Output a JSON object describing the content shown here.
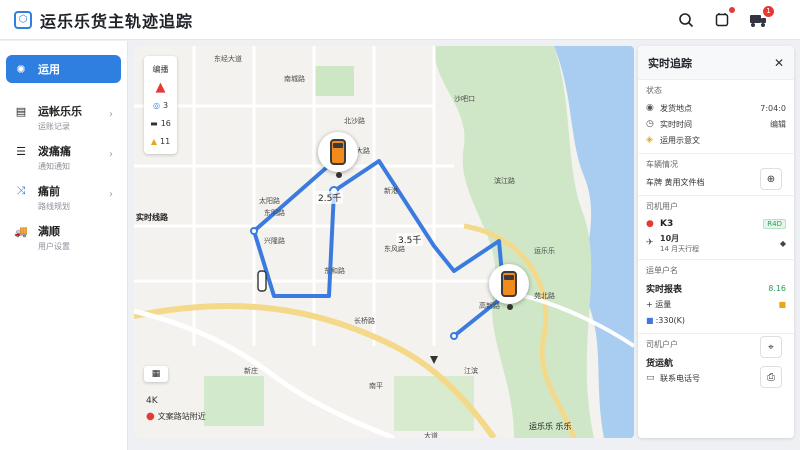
{
  "app": {
    "title": "运乐乐货主轨迹追踪",
    "logo_icon": "shield-icon"
  },
  "header": {
    "notification_count": "1"
  },
  "sidebar": {
    "items": [
      {
        "label": "运用",
        "sub": "",
        "icon": "loading-icon",
        "active": true
      },
      {
        "label": "运帐乐乐",
        "sub": "运账记录",
        "icon": "document-icon",
        "active": false
      },
      {
        "label": "泼痛痛",
        "sub": "通知通知",
        "icon": "list-icon",
        "active": false
      },
      {
        "label": "痛前",
        "sub": "路线规划",
        "icon": "route-icon",
        "active": false
      },
      {
        "label": "满顺",
        "sub": "用户设置",
        "icon": "truck-icon",
        "active": false
      }
    ]
  },
  "map": {
    "controls": [
      {
        "label": "编播"
      },
      {
        "label": "3"
      },
      {
        "label": "16"
      },
      {
        "label": "11"
      }
    ],
    "distance_1": "2.5千",
    "distance_2": "3.5千",
    "zoom_level": "4K",
    "location_name": "文案路站附近",
    "area_label": "实时线路",
    "labels": [
      "东经大道",
      "南城路",
      "北沙路",
      "沙吧口",
      "北大路",
      "太阳路",
      "东明路",
      "新港",
      "东风路",
      "兴隆路",
      "东和路",
      "高新路",
      "运乐乐",
      "滨江路",
      "苑北路",
      "长桥路",
      "南平",
      "新庄",
      "大道",
      "江滨",
      "运乐乐 乐乐"
    ]
  },
  "panel": {
    "title": "实时追踪",
    "status_title": "状态",
    "status_rows": [
      {
        "icon": "pin-icon",
        "label": "发货地点",
        "value": "7:04:0"
      },
      {
        "icon": "clock-icon",
        "label": "实时时间",
        "value": "编辑"
      },
      {
        "icon": "shield-icon",
        "label": "运用示意文",
        "value": ""
      }
    ],
    "vehicle_title": "车辆情况",
    "vehicle_row": {
      "label": "车牌 黄用文件档",
      "value": ""
    },
    "driver_title": "司机用户",
    "driver_rows": [
      {
        "icon": "pin-icon",
        "label": "K3",
        "badge": "R4D"
      },
      {
        "icon": "plane-icon",
        "label": "10月",
        "sub": "14 月天行程",
        "value": ""
      }
    ],
    "order_title": "运单户名",
    "order_rows": [
      {
        "label": "实时报表",
        "value": "8.16"
      },
      {
        "label": "+ 运量",
        "value": ""
      },
      {
        "label": ":330(K)",
        "value": ""
      }
    ],
    "driver2_title": "司机户户",
    "driver2_name": "货运航",
    "driver2_sub": "联系电话号"
  }
}
